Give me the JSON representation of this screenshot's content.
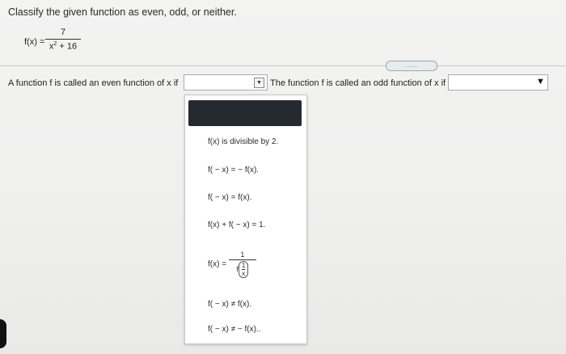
{
  "question": {
    "prompt": "Classify the given function as even, odd, or neither.",
    "function_label": "f(x) =",
    "numerator": "7",
    "denominator_base": "x",
    "denominator_exp": "2",
    "denominator_rest": " + 16"
  },
  "toolbar": {
    "more_label": "....."
  },
  "even_row": {
    "text": "A function f is called an even function of x if",
    "dropdown_value": ""
  },
  "odd_row": {
    "text": "The function f is called an odd function of x if",
    "dropdown_value": ""
  },
  "dropdown_options": [
    "f(x) is divisible by 2.",
    "f( − x) = − f(x).",
    "f( − x) = f(x).",
    "f(x) + f( − x) = 1.",
    "f(x) =",
    "f( − x) ≠ f(x).",
    "f( − x) ≠ − f(x).."
  ],
  "option5_parts": {
    "num": "1",
    "f": "f",
    "inner_num": "1",
    "inner_den": "x"
  },
  "icons": {
    "dropdown_arrow": "▼"
  }
}
